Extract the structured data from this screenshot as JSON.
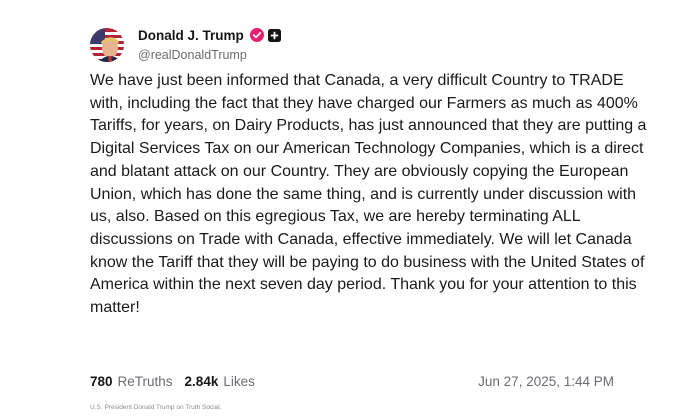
{
  "author": {
    "name": "Donald J. Trump",
    "handle": "@realDonaldTrump"
  },
  "icons": {
    "avatar": "user-avatar-flag",
    "verified": "verified-badge-icon",
    "bot": "account-type-badge-icon",
    "accent_color": "#e4216f"
  },
  "post": {
    "text": "We have just been informed that Canada, a very difficult Country to TRADE with, including the fact that they have charged our Farmers as much as 400% Tariffs, for years, on Dairy Products, has just announced that they are putting a Digital Services Tax on our American Technology Companies, which is a direct and blatant attack on our Country. They are obviously copying the European Union, which has done the same thing, and is currently under discussion with us, also. Based on this egregious Tax, we are hereby terminating ALL discussions on Trade with Canada, effective immediately. We will let Canada know the Tariff that they will be paying to do business with the United States of America within the next seven day period. Thank you for your attention to this matter!"
  },
  "metrics": {
    "retruths_count": "780",
    "retruths_label": "ReTruths",
    "likes_count": "2.84k",
    "likes_label": "Likes",
    "timestamp": "Jun 27, 2025, 1:44 PM"
  },
  "caption": "U.S. President Donald Trump on Truth Social."
}
